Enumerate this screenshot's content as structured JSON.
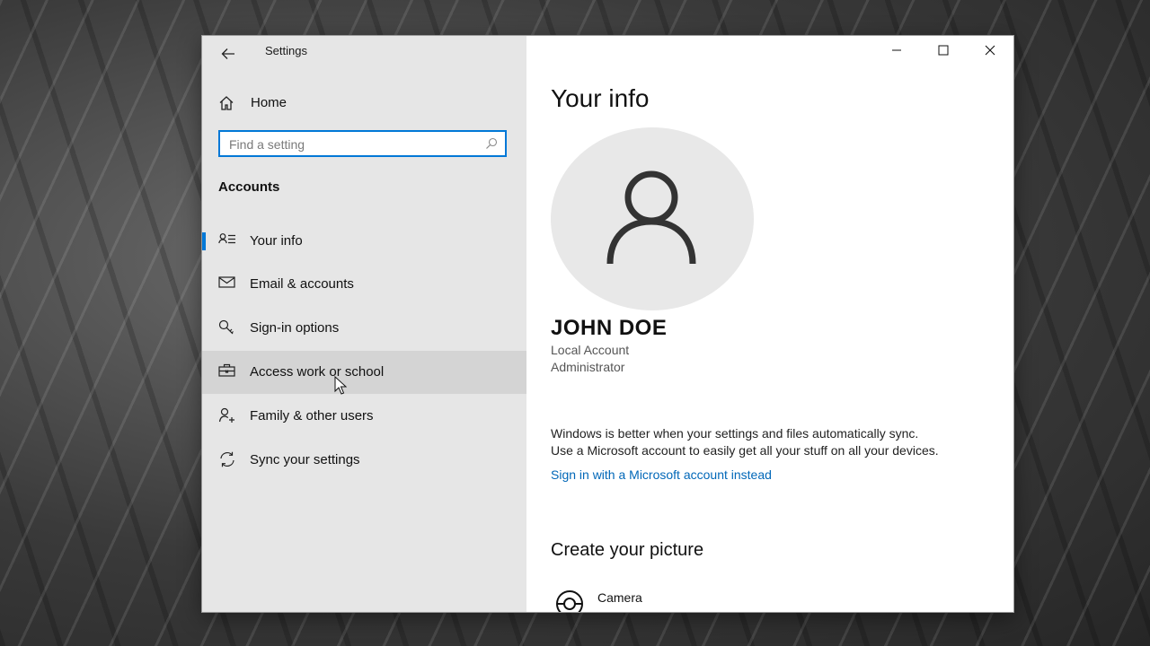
{
  "window": {
    "title": "Settings",
    "controls": [
      "minimize-icon",
      "maximize-icon",
      "close-icon"
    ]
  },
  "sidebar": {
    "home_label": "Home",
    "search": {
      "placeholder": "Find a setting",
      "value": ""
    },
    "section_title": "Accounts",
    "items": [
      {
        "label": "Your info",
        "icon": "user-info-icon",
        "selected": true
      },
      {
        "label": "Email & accounts",
        "icon": "mail-icon",
        "selected": false
      },
      {
        "label": "Sign-in options",
        "icon": "key-icon",
        "selected": false
      },
      {
        "label": "Access work or school",
        "icon": "briefcase-icon",
        "selected": false
      },
      {
        "label": "Family & other users",
        "icon": "add-user-icon",
        "selected": false
      },
      {
        "label": "Sync your settings",
        "icon": "sync-icon",
        "selected": false
      }
    ]
  },
  "main": {
    "title": "Your info",
    "user": {
      "name": "JOHN DOE",
      "account_type": "Local Account",
      "role": "Administrator"
    },
    "sync_lines": [
      "Windows is better when your settings and files automatically sync.",
      "Use a Microsoft account to easily get all your stuff on all your devices."
    ],
    "link_text": "Sign in with a Microsoft account instead",
    "section_title": "Create your picture",
    "picture_options": [
      {
        "label": "Camera",
        "icon": "camera-icon"
      }
    ]
  },
  "colors": {
    "accent": "#0078d7",
    "link": "#0067b8",
    "sidebar_bg": "#e6e6e6"
  }
}
